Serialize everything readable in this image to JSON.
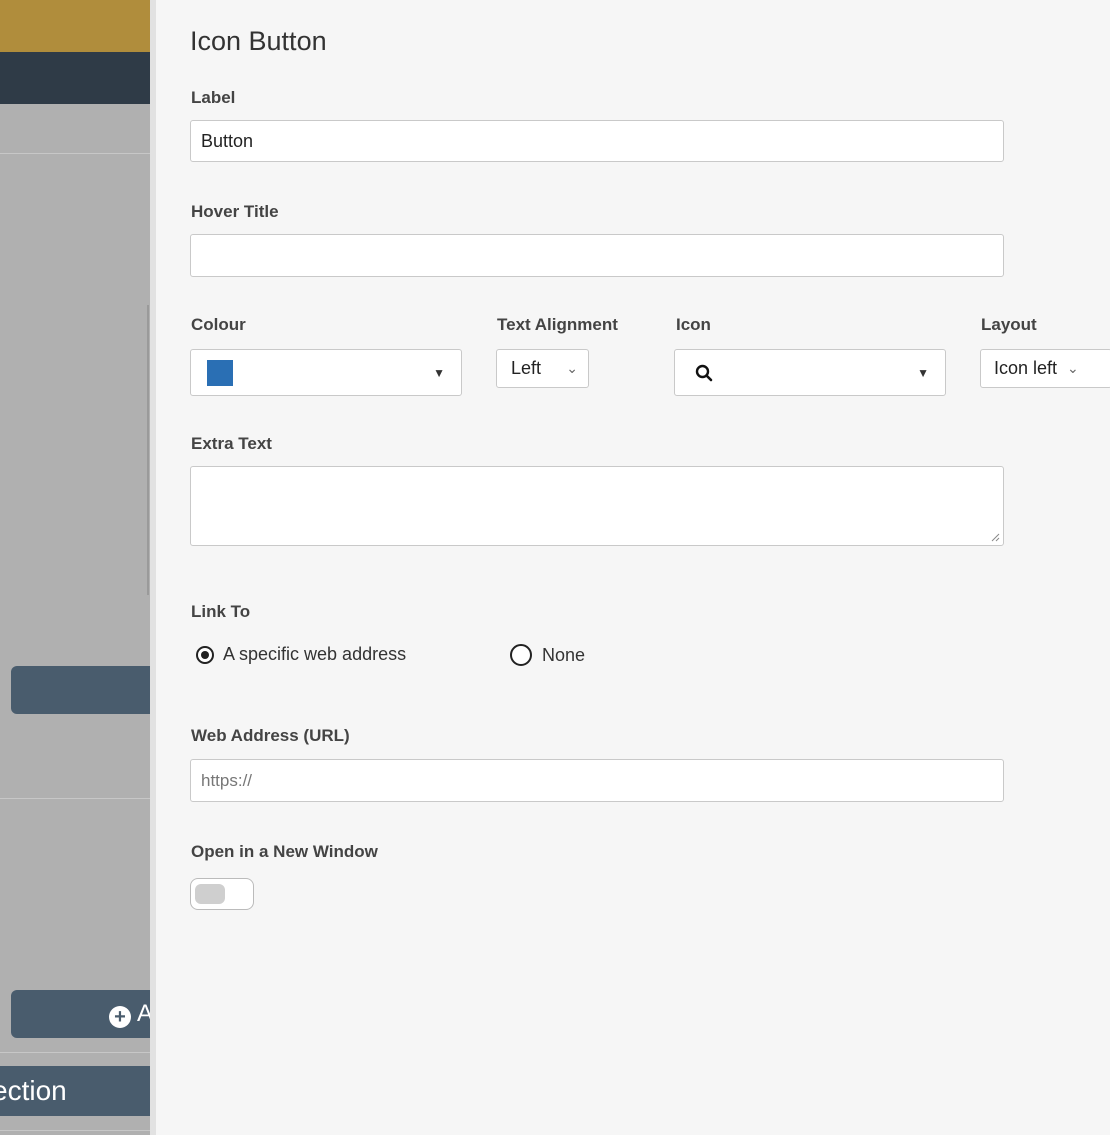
{
  "background": {
    "button_partial_text": "A",
    "section_partial_text": "ection"
  },
  "panel": {
    "title": "Icon Button",
    "label": {
      "label": "Label",
      "value": "Button"
    },
    "hover_title": {
      "label": "Hover Title",
      "value": ""
    },
    "colour": {
      "label": "Colour",
      "swatch": "#2a6fb4"
    },
    "text_alignment": {
      "label": "Text Alignment",
      "value": "Left"
    },
    "icon": {
      "label": "Icon",
      "value_icon": "search-icon"
    },
    "layout": {
      "label": "Layout",
      "value": "Icon left"
    },
    "extra_text": {
      "label": "Extra Text",
      "value": ""
    },
    "link_to": {
      "label": "Link To",
      "options": [
        {
          "label": "A specific web address",
          "selected": true
        },
        {
          "label": "None",
          "selected": false
        }
      ]
    },
    "web_address": {
      "label": "Web Address (URL)",
      "placeholder": "https://"
    },
    "new_window": {
      "label": "Open in a New Window",
      "on": false
    }
  }
}
